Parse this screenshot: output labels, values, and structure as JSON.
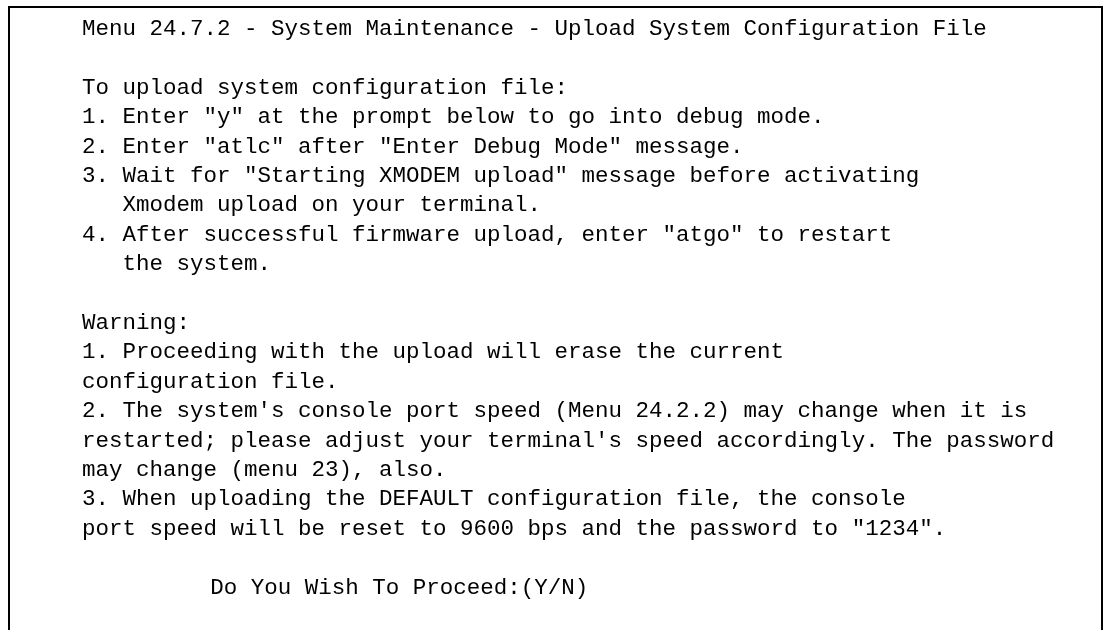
{
  "screen": {
    "title": "Menu 24.7.2 - System Maintenance - Upload System Configuration File",
    "instructions": {
      "heading": "To upload system configuration file:",
      "steps": [
        {
          "lines": [
            "1. Enter \"y\" at the prompt below to go into debug mode."
          ]
        },
        {
          "lines": [
            "2. Enter \"atlc\" after \"Enter Debug Mode\" message."
          ]
        },
        {
          "lines": [
            "3. Wait for \"Starting XMODEM upload\" message before activating",
            "Xmodem upload on your terminal."
          ]
        },
        {
          "lines": [
            "4. After successful firmware upload, enter \"atgo\" to restart",
            "the system."
          ]
        }
      ]
    },
    "warning": {
      "heading": "Warning:",
      "items": [
        {
          "lines": [
            "1. Proceeding with the upload will erase the current",
            "configuration file."
          ]
        },
        {
          "lines": [
            "2. The system's console port speed (Menu 24.2.2) may change when it is",
            "restarted; please adjust your terminal's speed accordingly. The password",
            "may change (menu 23), also."
          ]
        },
        {
          "lines": [
            "3. When uploading the DEFAULT configuration file, the console",
            "port speed will be reset to 9600 bps and the password to \"1234\"."
          ]
        }
      ]
    },
    "prompt": "Do You Wish To Proceed:(Y/N)"
  }
}
